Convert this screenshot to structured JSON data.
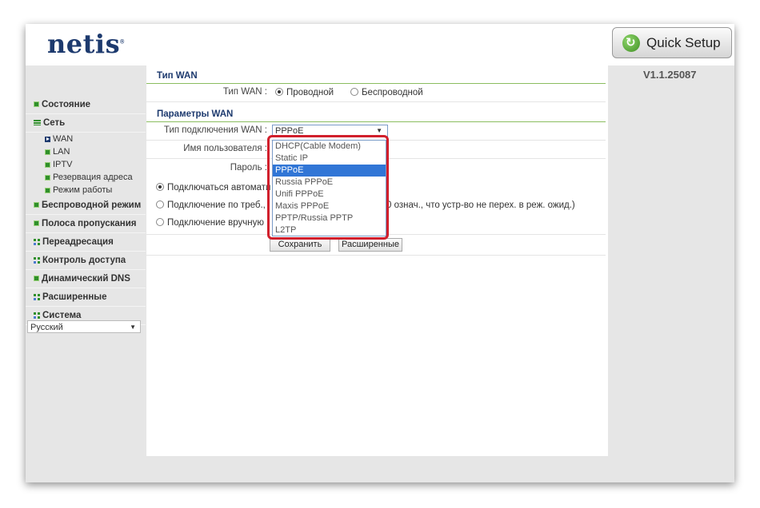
{
  "brand": "netis",
  "brand_mark": "®",
  "quick_setup": "Quick Setup",
  "version": "V1.1.25087",
  "sidebar": {
    "items": [
      {
        "label": "Состояние"
      },
      {
        "label": "Сеть"
      },
      {
        "label": "Беспроводной режим"
      },
      {
        "label": "Полоса пропускания"
      },
      {
        "label": "Переадресация"
      },
      {
        "label": "Контроль доступа"
      },
      {
        "label": "Динамический DNS"
      },
      {
        "label": "Расширенные"
      },
      {
        "label": "Система"
      }
    ],
    "subitems": [
      {
        "label": "WAN"
      },
      {
        "label": "LAN"
      },
      {
        "label": "IPTV"
      },
      {
        "label": "Резервация адреса"
      },
      {
        "label": "Режим работы"
      }
    ],
    "language": "Русский"
  },
  "wan_type": {
    "section_title": "Тип WAN",
    "label": "Тип WAN :",
    "options": [
      "Проводной",
      "Беспроводной"
    ],
    "selected": "Проводной"
  },
  "wan_params": {
    "section_title": "Параметры WAN",
    "connection_type_label": "Тип подключения WAN :",
    "connection_type_value": "PPPoE",
    "username_label": "Имя пользователя :",
    "password_label": "Пароль :",
    "modes": [
      "Подключаться автомати",
      "Подключение по треб.,",
      "Подключение вручную"
    ],
    "mode_hint": "0 означ., что устр-во не перех. в реж. ожид.)",
    "selected_mode": 0
  },
  "buttons": {
    "save": "Сохранить",
    "advanced": "Расширенные"
  },
  "dropdown": {
    "options": [
      "DHCP(Cable Modem)",
      "Static IP",
      "PPPoE",
      "Russia PPPoE",
      "Unifi PPPoE",
      "Maxis PPPoE",
      "PPTP/Russia PPTP",
      "L2TP"
    ],
    "highlighted": "PPPoE"
  },
  "colors": {
    "accent_green": "#2f8f2a",
    "section_title": "#1d3a6e",
    "highlight": "#d11f2c",
    "selection": "#3176d6"
  }
}
